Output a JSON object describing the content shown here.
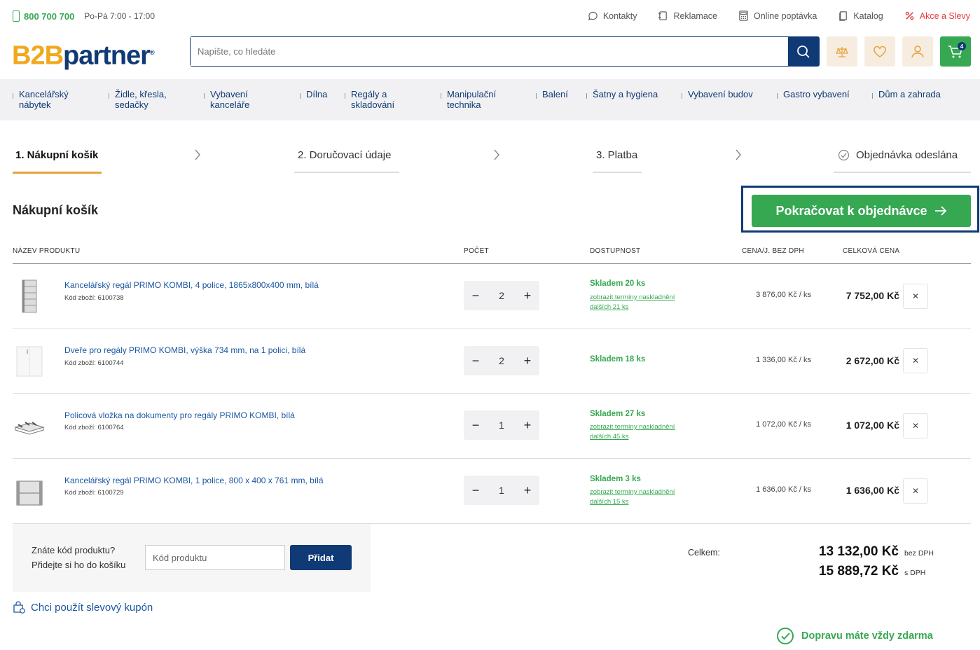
{
  "topbar": {
    "phone": "800 700 700",
    "hours": "Po-Pá 7:00 - 17:00",
    "links": [
      {
        "label": "Kontakty",
        "icon": "chat-icon"
      },
      {
        "label": "Reklamace",
        "icon": "return-icon"
      },
      {
        "label": "Online poptávka",
        "icon": "calculator-icon"
      },
      {
        "label": "Katalog",
        "icon": "catalog-icon"
      },
      {
        "label": "Akce a Slevy",
        "icon": "percent-icon"
      }
    ]
  },
  "header": {
    "logo_b2b": "B2B",
    "logo_partner": "partner",
    "logo_reg": "®",
    "search_placeholder": "Napište, co hledáte",
    "cart_count": "4"
  },
  "categories": [
    [
      "Kancelářský",
      "nábytek"
    ],
    [
      "Židle, křesla,",
      "sedačky"
    ],
    [
      "Vybavení",
      "kanceláře"
    ],
    [
      "Dílna",
      ""
    ],
    [
      "Regály a",
      "skladování"
    ],
    [
      "Manipulační",
      "technika"
    ],
    [
      "Balení",
      ""
    ],
    [
      "Šatny a hygiena",
      ""
    ],
    [
      "Vybavení budov",
      ""
    ],
    [
      "Gastro vybavení",
      ""
    ],
    [
      "Dům a zahrada",
      ""
    ]
  ],
  "steps": [
    "1. Nákupní košík",
    "2. Doručovací údaje",
    "3. Platba",
    "Objednávka odeslána"
  ],
  "cart": {
    "title": "Nákupní košík",
    "cta": "Pokračovat k objednávce",
    "headers": {
      "product": "NÁZEV PRODUKTU",
      "qty": "POČET",
      "availability": "DOSTUPNOST",
      "unit_price": "CENA/J. BEZ DPH",
      "total": "CELKOVÁ CENA"
    },
    "items": [
      {
        "name": "Kancelářský regál PRIMO KOMBI, 4 police, 1865x800x400 mm, bílá",
        "code": "Kód zboží: 6100738",
        "qty": "2",
        "stock": "Skladem 20 ks",
        "link1": "zobrazit termíny naskladnění",
        "link2": "dalších 21 ks",
        "unit": "3 876,00 Kč / ks",
        "total": "7 752,00 Kč"
      },
      {
        "name": "Dveře pro regály PRIMO KOMBI, výška 734 mm, na 1 polici, bílá",
        "code": "Kód zboží: 6100744",
        "qty": "2",
        "stock": "Skladem 18 ks",
        "link1": "",
        "link2": "",
        "unit": "1 336,00 Kč / ks",
        "total": "2 672,00 Kč"
      },
      {
        "name": "Policová vložka na dokumenty pro regály PRIMO KOMBI, bílá",
        "code": "Kód zboží: 6100764",
        "qty": "1",
        "stock": "Skladem 27 ks",
        "link1": "zobrazit termíny naskladnění",
        "link2": "dalších 45 ks",
        "unit": "1 072,00 Kč / ks",
        "total": "1 072,00 Kč"
      },
      {
        "name": "Kancelářský regál PRIMO KOMBI, 1 police, 800 x 400 x 761 mm, bílá",
        "code": "Kód zboží: 6100729",
        "qty": "1",
        "stock": "Skladem 3 ks",
        "link1": "zobrazit termíny naskladnění",
        "link2": "dalších 15 ks",
        "unit": "1 636,00 Kč / ks",
        "total": "1 636,00 Kč"
      }
    ]
  },
  "code_box": {
    "line1": "Znáte kód produktu?",
    "line2": "Přidejte si ho do košíku",
    "placeholder": "Kód produktu",
    "button": "Přidat"
  },
  "coupon": "Chci použít slevový kupón",
  "summary": {
    "label": "Celkem:",
    "without_vat": "13 132,00 Kč",
    "without_vat_suffix": "bez DPH",
    "with_vat": "15 889,72 Kč",
    "with_vat_suffix": "s DPH"
  },
  "free_shipping": "Dopravu máte vždy zdarma",
  "colors": {
    "green": "#36a852",
    "navy": "#0f3a75",
    "orange": "#e8a33d",
    "link": "#1b57a0"
  }
}
